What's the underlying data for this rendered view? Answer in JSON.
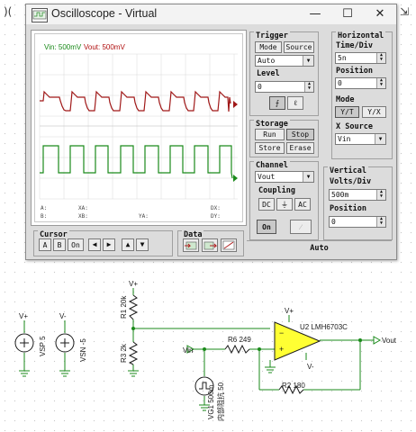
{
  "window": {
    "title": "Oscilloscope - Virtual",
    "controls": {
      "minimize": "—",
      "maximize": "☐",
      "close": "✕"
    }
  },
  "screen": {
    "legend_vin": "Vin: 500mV",
    "legend_vout": "Vout: 500mV",
    "readouts": {
      "a_label": "A:",
      "xa_label": "XA:",
      "dx_label": "DX:",
      "b_label": "B:",
      "xb_label": "XB:",
      "ya_label": "YA:",
      "dy_label": "DY:",
      "yb_label": "YB:"
    }
  },
  "trigger": {
    "title": "Trigger",
    "mode_label": "Mode",
    "source_label": "Source",
    "mode_value": "Auto",
    "level_label": "Level",
    "level_value": "0"
  },
  "horizontal": {
    "title": "Horizontal",
    "time_div_label": "Time/Div",
    "time_div_value": "5n",
    "position_label": "Position",
    "position_value": "0",
    "mode_label": "Mode",
    "mode_yt": "Y/T",
    "mode_yx": "Y/X",
    "xsource_label": "X Source",
    "xsource_value": "Vin"
  },
  "storage": {
    "title": "Storage",
    "run": "Run",
    "stop": "Stop",
    "store": "Store",
    "erase": "Erase"
  },
  "channel": {
    "title": "Channel",
    "value": "Vout",
    "coupling_label": "Coupling",
    "dc": "DC",
    "gnd": "⏚",
    "ac": "AC",
    "on": "On"
  },
  "vertical": {
    "title": "Vertical",
    "volts_div_label": "Volts/Div",
    "volts_div_value": "500m",
    "position_label": "Position",
    "position_value": "0"
  },
  "cursor": {
    "title": "Cursor",
    "a": "A",
    "b": "B",
    "on": "On"
  },
  "data_panel": {
    "title": "Data"
  },
  "status": {
    "text": "Auto"
  },
  "schematic": {
    "vplus": "V+",
    "vminus": "V-",
    "vsp": "VSP 5",
    "vsn": "VSN -5",
    "r1": "R1 20k",
    "r3": "R3 2k",
    "r6": "R6 249",
    "r2": "R2 180",
    "opamp": "U2 LMH6703C",
    "vin": "Vin",
    "vout": "Vout",
    "vg1": "VG1 500m",
    "vg1_sub": "内部阻抗 50"
  },
  "colors": {
    "vin_trace": "#1a8a1a",
    "vout_trace": "#a01818",
    "wire": "#1a8a1a",
    "component": "#1a1a1a"
  }
}
